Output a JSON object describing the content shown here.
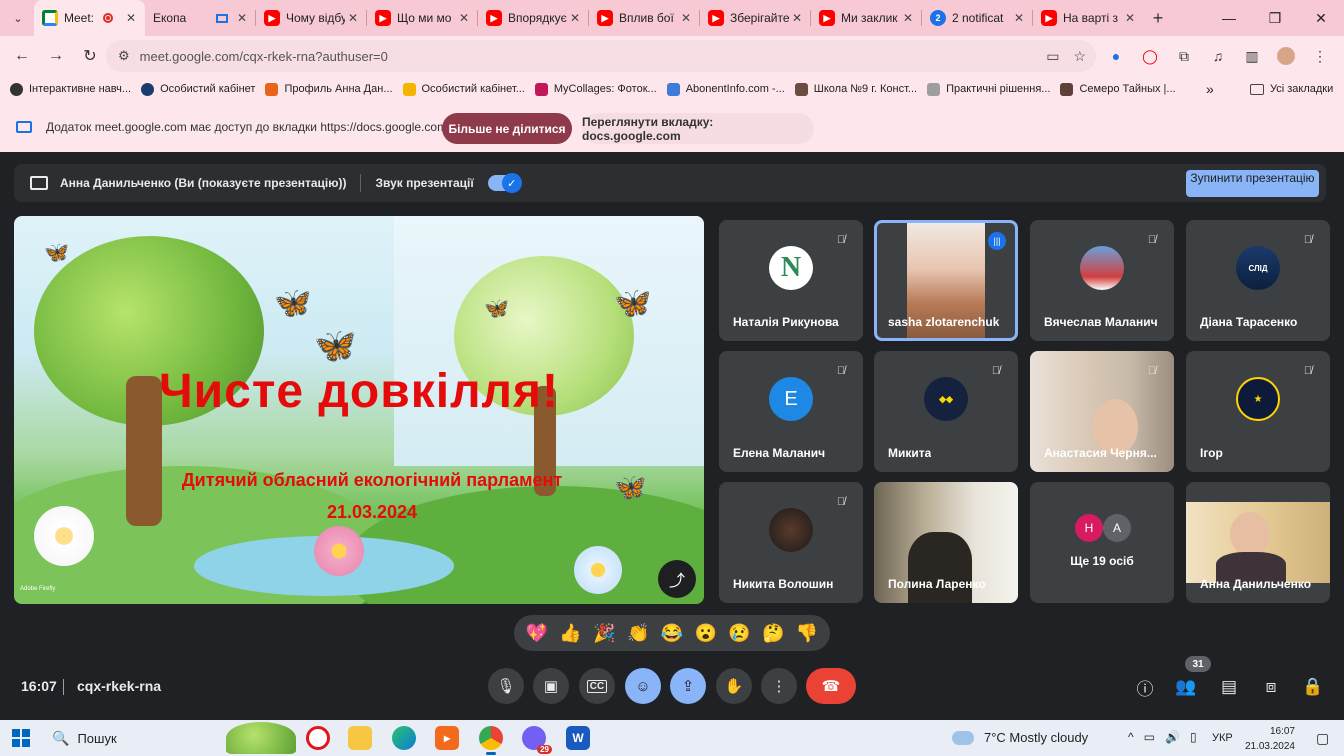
{
  "browser": {
    "tabs": [
      {
        "title": "Meet:",
        "favicon": "meet-icon",
        "active": true,
        "recording": true
      },
      {
        "title": "Екопа",
        "favicon": "slides-icon"
      },
      {
        "title": "Чому відбу",
        "favicon": "youtube-icon"
      },
      {
        "title": "Що ми мо",
        "favicon": "youtube-icon"
      },
      {
        "title": "Впорядкує",
        "favicon": "youtube-icon"
      },
      {
        "title": "Вплив бої",
        "favicon": "youtube-icon"
      },
      {
        "title": "Зберігайте",
        "favicon": "youtube-icon"
      },
      {
        "title": "Ми заклик",
        "favicon": "youtube-icon"
      },
      {
        "title": "2 notificat",
        "favicon": "notification-icon",
        "badge": "2"
      },
      {
        "title": "На варті з",
        "favicon": "youtube-icon"
      }
    ],
    "url": "meet.google.com/cqx-rkek-rna?authuser=0",
    "bookmarks": [
      "Інтерактивне навч...",
      "Особистий кабінет",
      "Профиль Анна Дан...",
      "Особистий кабінет...",
      "MyCollages: Фоток...",
      "AbonentInfo.com -...",
      "Школа №9 г. Конст...",
      "Практичні рішення...",
      "Семеро Тайных |..."
    ],
    "bookmarks_more": "»",
    "all_bookmarks": "Усі закладки"
  },
  "share_banner": {
    "text": "Додаток meet.google.com має доступ до вкладки https://docs.google.com",
    "stop_label": "Більше не ділитися",
    "view_label": "Переглянути вкладку: docs.google.com"
  },
  "presenting": {
    "text": "Анна Данильченко (Ви (показуєте презентацію))",
    "audio_label": "Звук презентації",
    "audio_on": true,
    "stop_label": "Зупинити презентацію"
  },
  "slide": {
    "title": "Чисте довкілля!",
    "subtitle": "Дитячий обласний екологічний парламент",
    "date": "21.03.2024",
    "watermark": "Adobe Firefly"
  },
  "participants": [
    {
      "name": "Наталія Рикунова",
      "avatar": "N",
      "muted": true
    },
    {
      "name": "sasha zlotarenchuk",
      "speaking": true,
      "video": true
    },
    {
      "name": "Вячеслав Маланич",
      "muted": true
    },
    {
      "name": "Діана Тарасенко",
      "avatar": "СЛІД",
      "muted": true
    },
    {
      "name": "Елена Маланич",
      "avatar": "Е",
      "muted": true
    },
    {
      "name": "Микита",
      "muted": true
    },
    {
      "name": "Анастасия Черня...",
      "muted": true,
      "video": true
    },
    {
      "name": "Ігор",
      "muted": true
    },
    {
      "name": "Никита Волошин",
      "muted": true
    },
    {
      "name": "Полина Ларенко",
      "muted": true,
      "video": true
    },
    {
      "more_label": "Ще 19 осіб",
      "initials": [
        "Н",
        "А"
      ]
    },
    {
      "name": "Анна Данильченко",
      "video": true
    }
  ],
  "reactions": [
    "💖",
    "👍",
    "🎉",
    "👏",
    "😂",
    "😮",
    "😢",
    "🤔",
    "👎"
  ],
  "callbar": {
    "time": "16:07",
    "meeting_code": "cqx-rkek-rna",
    "people_count": "31"
  },
  "taskbar": {
    "search_placeholder": "Пошук",
    "chrome_badge": "29",
    "weather": "7°C  Mostly cloudy",
    "language": "УКР",
    "time": "16:07",
    "date": "21.03.2024"
  },
  "colors": {
    "meet_bg": "#202124",
    "tile_bg": "#3c4043",
    "accent_blue": "#8ab4f8",
    "end_call_red": "#ea4335",
    "slide_title_red": "#e60b0b",
    "browser_frame_pink": "#f6c9d4"
  }
}
